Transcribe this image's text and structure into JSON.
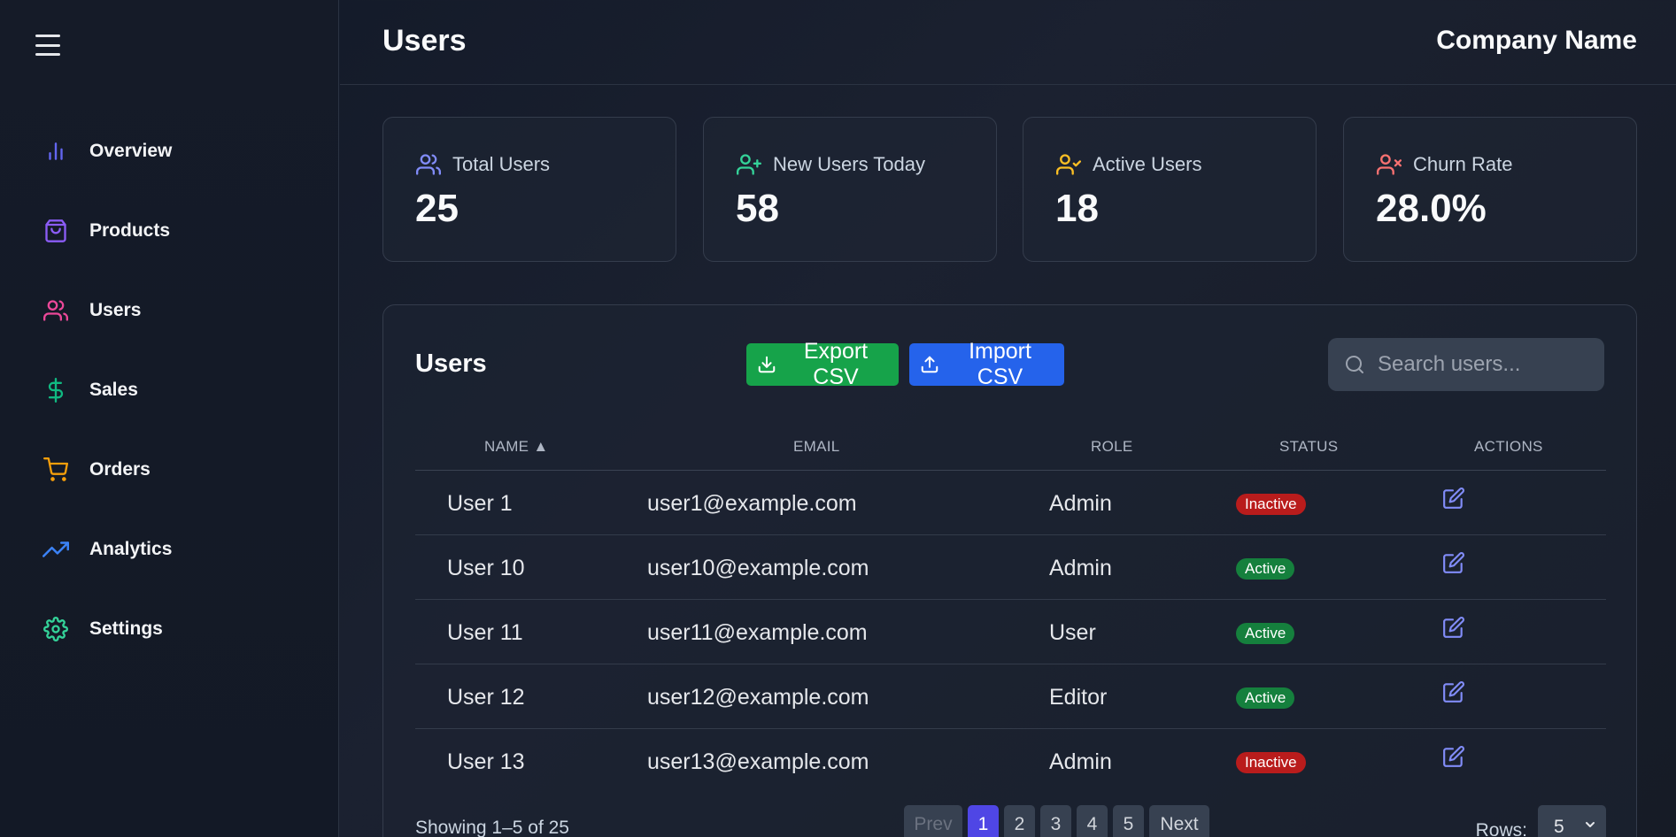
{
  "sidebar": {
    "items": [
      {
        "label": "Overview",
        "icon": "bar-chart-icon",
        "color": "#6366f1"
      },
      {
        "label": "Products",
        "icon": "shopping-bag-icon",
        "color": "#8b5cf6"
      },
      {
        "label": "Users",
        "icon": "users-icon",
        "color": "#ec4899"
      },
      {
        "label": "Sales",
        "icon": "dollar-sign-icon",
        "color": "#10b981"
      },
      {
        "label": "Orders",
        "icon": "shopping-cart-icon",
        "color": "#f59e0b"
      },
      {
        "label": "Analytics",
        "icon": "trending-up-icon",
        "color": "#3b82f6"
      },
      {
        "label": "Settings",
        "icon": "settings-icon",
        "color": "#34d399"
      }
    ]
  },
  "header": {
    "title": "Users",
    "company": "Company Name"
  },
  "stats": [
    {
      "label": "Total Users",
      "value": "25",
      "icon": "users-icon",
      "color": "#818cf8"
    },
    {
      "label": "New Users Today",
      "value": "58",
      "icon": "user-plus-icon",
      "color": "#34d399"
    },
    {
      "label": "Active Users",
      "value": "18",
      "icon": "user-check-icon",
      "color": "#fbbf24"
    },
    {
      "label": "Churn Rate",
      "value": "28.0%",
      "icon": "user-x-icon",
      "color": "#f87171"
    }
  ],
  "table": {
    "title": "Users",
    "export_label": "Export CSV",
    "import_label": "Import CSV",
    "search_placeholder": "Search users...",
    "columns": {
      "name": "NAME ▲",
      "email": "EMAIL",
      "role": "ROLE",
      "status": "STATUS",
      "actions": "ACTIONS"
    },
    "rows": [
      {
        "name": "User 1",
        "email": "user1@example.com",
        "role": "Admin",
        "status": "Inactive"
      },
      {
        "name": "User 10",
        "email": "user10@example.com",
        "role": "Admin",
        "status": "Active"
      },
      {
        "name": "User 11",
        "email": "user11@example.com",
        "role": "User",
        "status": "Active"
      },
      {
        "name": "User 12",
        "email": "user12@example.com",
        "role": "Editor",
        "status": "Active"
      },
      {
        "name": "User 13",
        "email": "user13@example.com",
        "role": "Admin",
        "status": "Inactive"
      }
    ],
    "showing": "Showing 1–5 of 25",
    "pagination": {
      "prev": "Prev",
      "pages": [
        "1",
        "2",
        "3",
        "4",
        "5"
      ],
      "current": "1",
      "next": "Next"
    },
    "rows_label": "Rows:",
    "rows_value": "5"
  },
  "colors": {
    "export": "#16a34a",
    "import": "#2563eb",
    "active": "#15803d",
    "inactive": "#b91c1c",
    "current_page": "#4f46e5",
    "edit_icon": "#818cf8"
  }
}
